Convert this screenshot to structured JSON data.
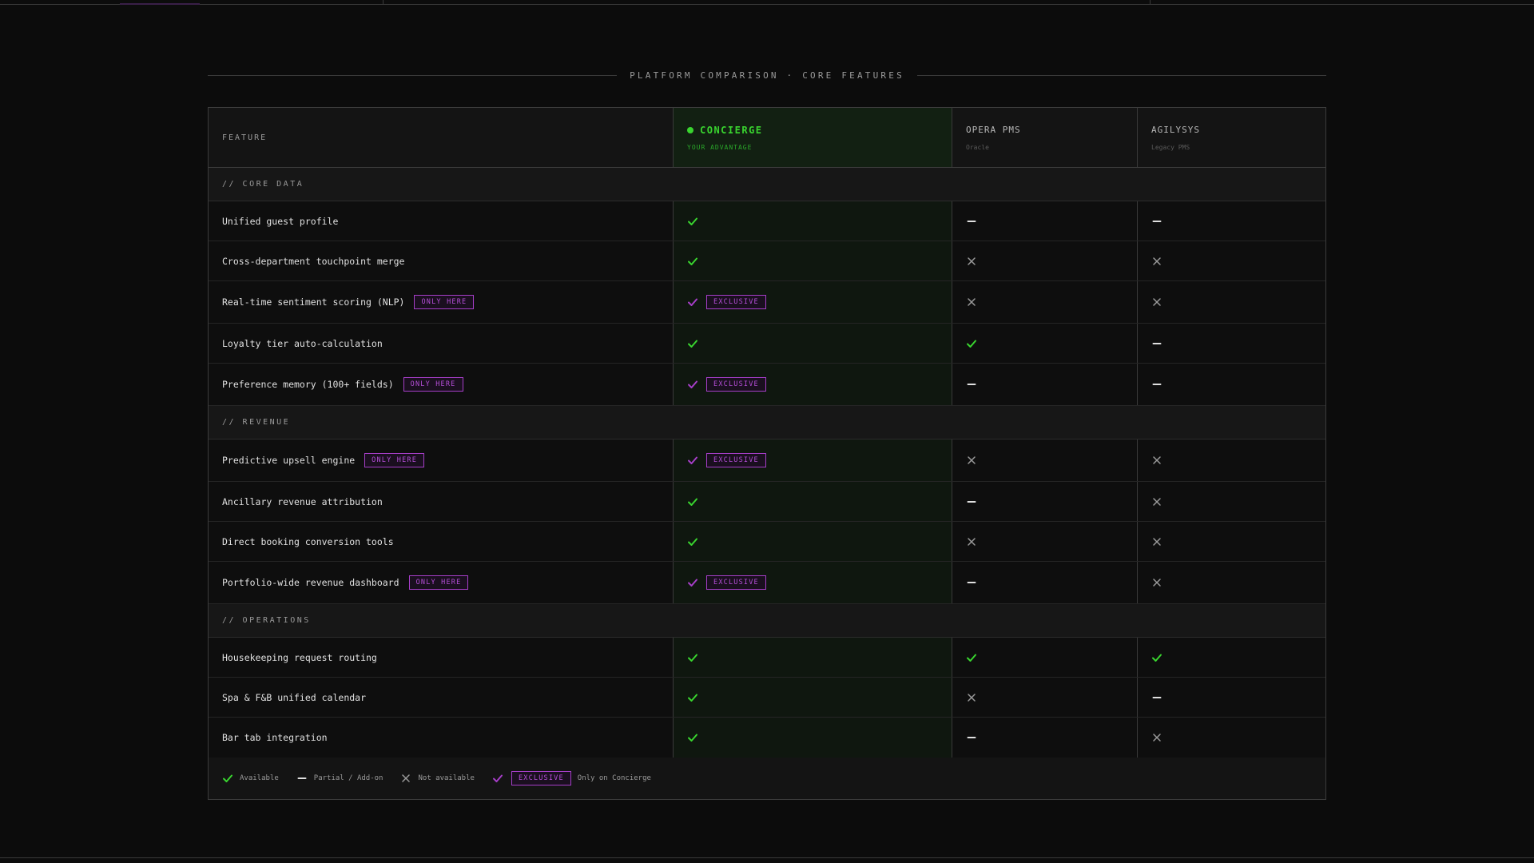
{
  "title": "PLATFORM COMPARISON · CORE FEATURES",
  "colors": {
    "accent_green": "#39d52f",
    "accent_purple": "#a63ec8",
    "not_available_gray": "#9a9a9a"
  },
  "header": {
    "feature_label": "FEATURE",
    "concierge_name": "CONCIERGE",
    "concierge_sub": "YOUR ADVANTAGE",
    "opera_name": "OPERA PMS",
    "opera_sub": "Oracle",
    "agilysys_name": "AGILYSYS",
    "agilysys_sub": "Legacy PMS"
  },
  "sections": [
    {
      "label": "// CORE DATA",
      "rows": [
        {
          "feature": "Unified guest profile",
          "badge": "",
          "concierge": "check",
          "concierge_badge": "",
          "opera": "partial",
          "agilysys": "partial"
        },
        {
          "feature": "Cross-department touchpoint merge",
          "badge": "",
          "concierge": "check",
          "concierge_badge": "",
          "opera": "x",
          "agilysys": "x"
        },
        {
          "feature": "Real-time sentiment scoring (NLP)",
          "badge": "ONLY HERE",
          "concierge": "exclusive",
          "concierge_badge": "EXCLUSIVE",
          "opera": "x",
          "agilysys": "x"
        },
        {
          "feature": "Loyalty tier auto-calculation",
          "badge": "",
          "concierge": "check",
          "concierge_badge": "",
          "opera": "check",
          "agilysys": "partial"
        },
        {
          "feature": "Preference memory (100+ fields)",
          "badge": "ONLY HERE",
          "concierge": "exclusive",
          "concierge_badge": "EXCLUSIVE",
          "opera": "partial",
          "agilysys": "partial"
        }
      ]
    },
    {
      "label": "// REVENUE",
      "rows": [
        {
          "feature": "Predictive upsell engine",
          "badge": "ONLY HERE",
          "concierge": "exclusive",
          "concierge_badge": "EXCLUSIVE",
          "opera": "x",
          "agilysys": "x"
        },
        {
          "feature": "Ancillary revenue attribution",
          "badge": "",
          "concierge": "check",
          "concierge_badge": "",
          "opera": "partial",
          "agilysys": "x"
        },
        {
          "feature": "Direct booking conversion tools",
          "badge": "",
          "concierge": "check",
          "concierge_badge": "",
          "opera": "x",
          "agilysys": "x"
        },
        {
          "feature": "Portfolio-wide revenue dashboard",
          "badge": "ONLY HERE",
          "concierge": "exclusive",
          "concierge_badge": "EXCLUSIVE",
          "opera": "partial",
          "agilysys": "x"
        }
      ]
    },
    {
      "label": "// OPERATIONS",
      "rows": [
        {
          "feature": "Housekeeping request routing",
          "badge": "",
          "concierge": "check",
          "concierge_badge": "",
          "opera": "check",
          "agilysys": "check"
        },
        {
          "feature": "Spa & F&B unified calendar",
          "badge": "",
          "concierge": "check",
          "concierge_badge": "",
          "opera": "x",
          "agilysys": "partial"
        },
        {
          "feature": "Bar tab integration",
          "badge": "",
          "concierge": "check",
          "concierge_badge": "",
          "opera": "partial",
          "agilysys": "x"
        }
      ]
    }
  ],
  "legend": {
    "available": "Available",
    "partial": "Partial / Add-on",
    "not_available": "Not available",
    "exclusive_badge": "EXCLUSIVE",
    "exclusive_text": "Only on Concierge"
  }
}
